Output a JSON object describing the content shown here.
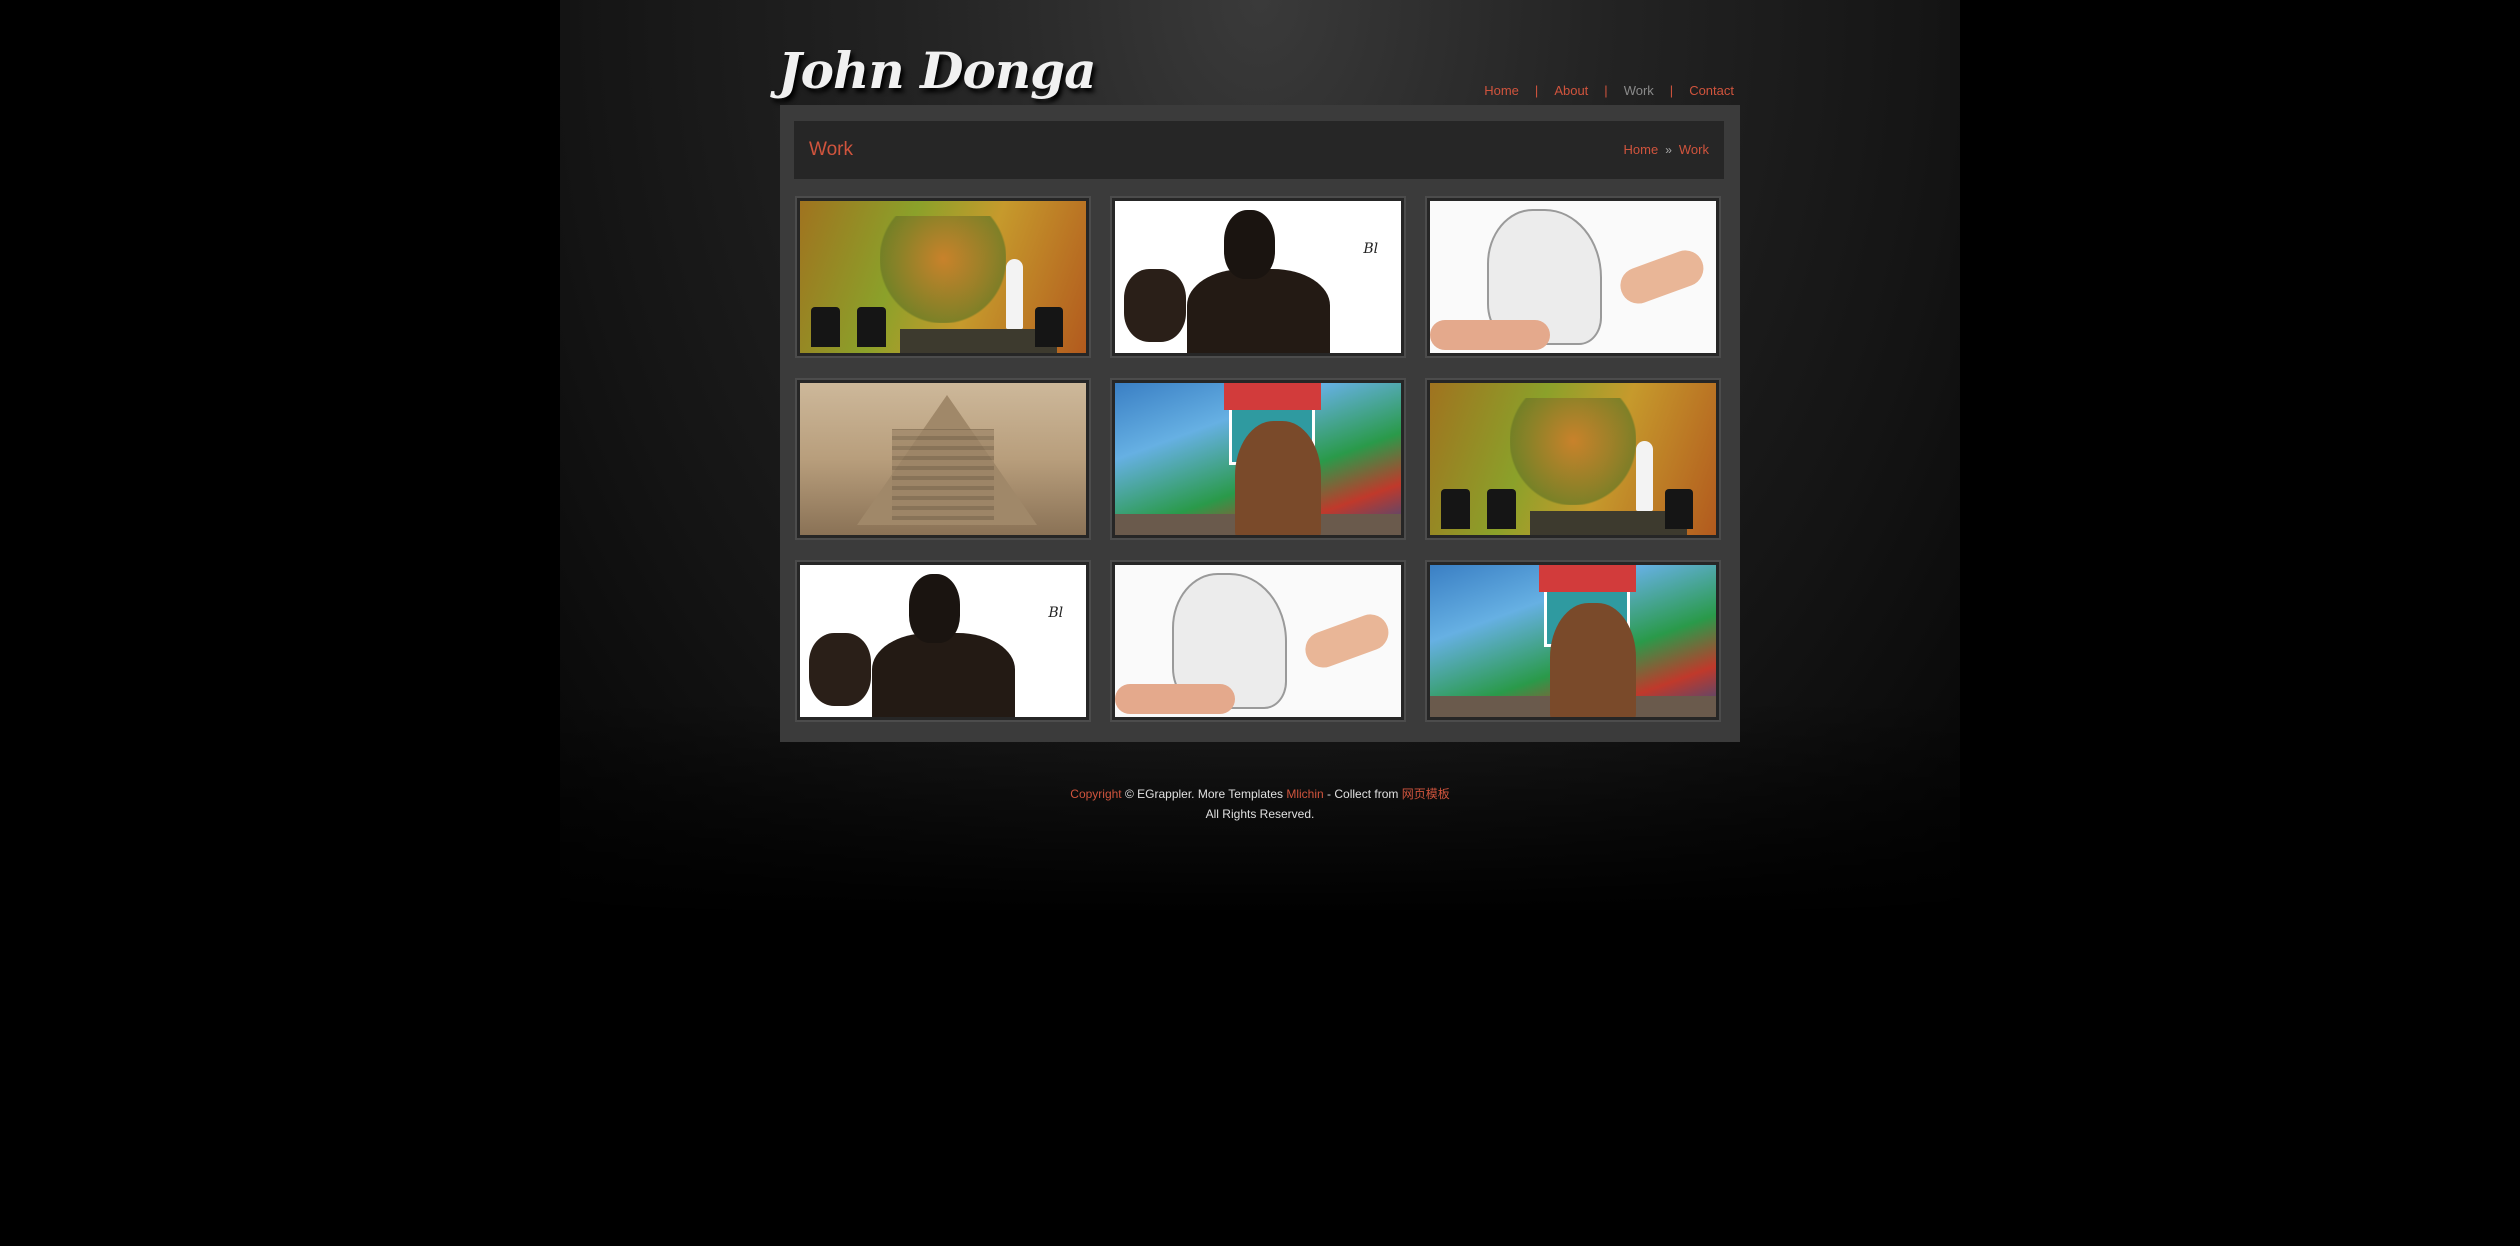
{
  "site": {
    "logo": "John Donga"
  },
  "nav": {
    "items": [
      {
        "label": "Home"
      },
      {
        "label": "About"
      },
      {
        "label": "Work",
        "current": true
      },
      {
        "label": "Contact"
      }
    ],
    "separator": "|"
  },
  "page": {
    "title": "Work",
    "breadcrumb": {
      "home": "Home",
      "arrow": "»",
      "current": "Work"
    }
  },
  "gallery": {
    "thumbnails": [
      {
        "subject": "mosaic-portrait-wall"
      },
      {
        "subject": "ink-portrait"
      },
      {
        "subject": "pencil-sketch-drawing"
      },
      {
        "subject": "3d-pyramid-street-art"
      },
      {
        "subject": "painting-mural"
      },
      {
        "subject": "mosaic-portrait-wall"
      },
      {
        "subject": "ink-portrait"
      },
      {
        "subject": "pencil-sketch-drawing"
      },
      {
        "subject": "painting-mural"
      }
    ]
  },
  "footer": {
    "copyright_link": "Copyright",
    "copyright_text": " © EGrappler. More Templates ",
    "templates_link": "Mlichin",
    "collect_text": " - Collect from ",
    "collect_link": "网页模板",
    "rights": "All Rights Reserved."
  },
  "colors": {
    "accent": "#d0543d",
    "content_bg": "#3b3b3b",
    "titlebar_bg": "#262626",
    "page_bg": "#000000"
  }
}
